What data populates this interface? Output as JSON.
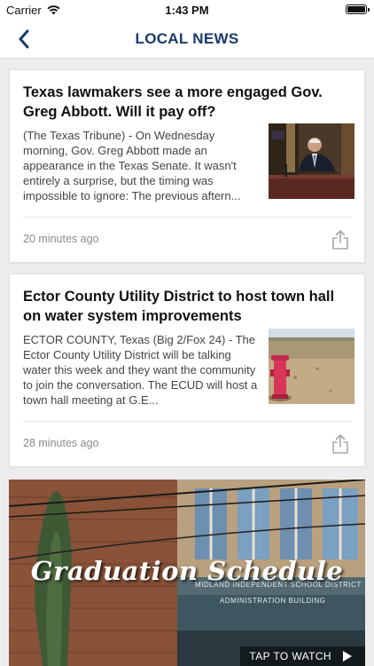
{
  "status_bar": {
    "carrier": "Carrier",
    "time": "1:43 PM",
    "wifi_icon": "wifi-icon",
    "battery_icon": "battery-icon"
  },
  "nav": {
    "title": "LOCAL NEWS",
    "back_icon": "chevron-left-icon",
    "accent_color": "#1a3a6b"
  },
  "articles": [
    {
      "title": "Texas lawmakers see a more engaged Gov. Greg Abbott. Will it pay off?",
      "summary": "(The Texas Tribune) - On Wednesday morning, Gov. Greg Abbott made an appearance in the Texas Senate. It wasn't entirely a surprise, but the timing was impossible to ignore: The previous aftern...",
      "time": "20 minutes ago",
      "share_icon": "share-icon"
    },
    {
      "title": "Ector County Utility District to host town hall on water system improvements",
      "summary": "ECTOR COUNTY, Texas (Big 2/Fox 24) - The Ector County Utility District will be talking water this week and they want the community to join the conversation. The ECUD will host a town hall meeting at G.E...",
      "time": "28 minutes ago",
      "share_icon": "share-icon"
    }
  ],
  "video": {
    "overlay_title": "Graduation Schedule",
    "building_sign_1": "MIDLAND INDEPENDENT SCHOOL DISTRICT",
    "building_sign_2": "ADMINISTRATION BUILDING",
    "cta_label": "TAP TO WATCH",
    "play_icon": "play-icon"
  }
}
